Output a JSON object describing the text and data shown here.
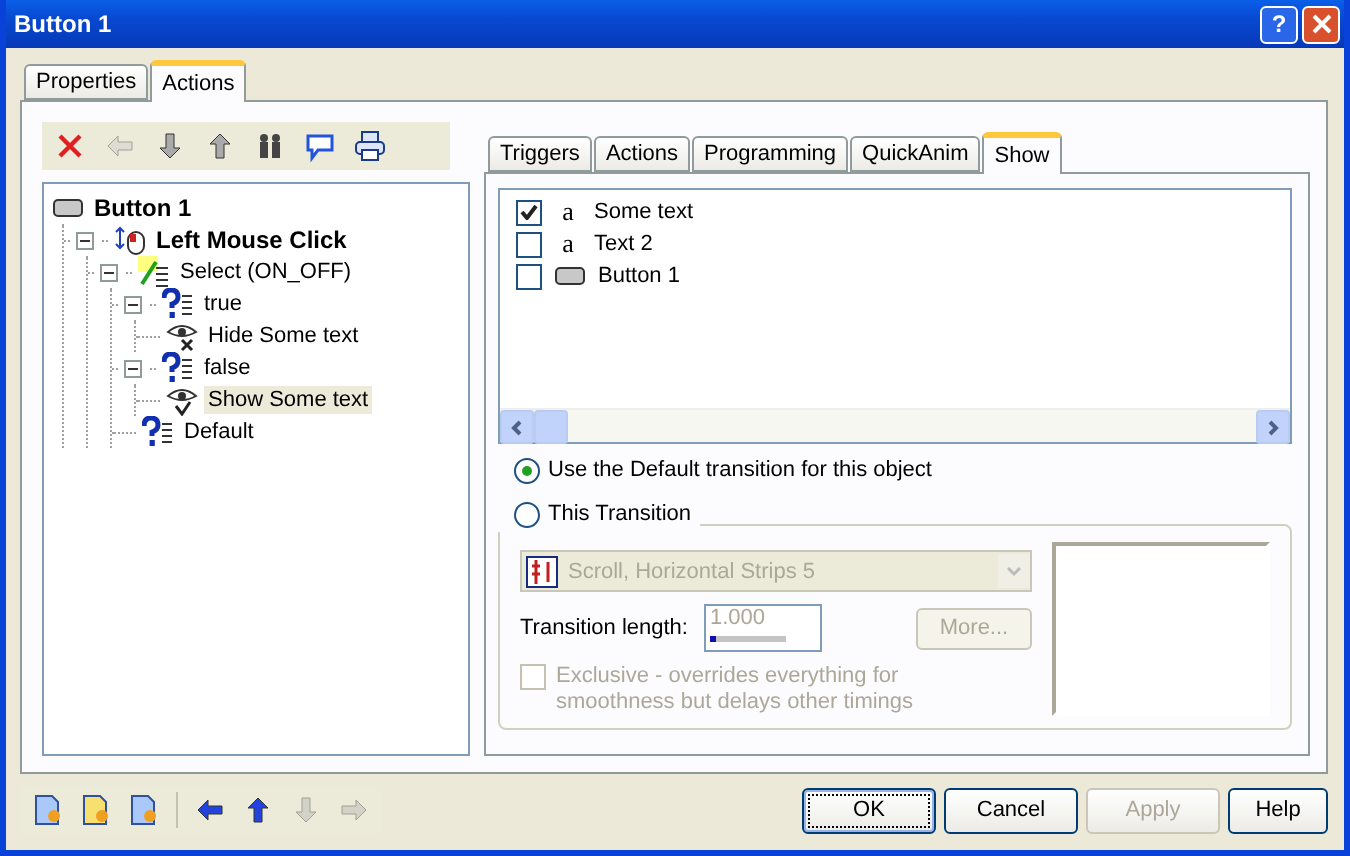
{
  "window": {
    "title": "Button 1",
    "help_button": "?"
  },
  "tabs": [
    {
      "label": "Properties",
      "selected": false
    },
    {
      "label": "Actions",
      "selected": true
    }
  ],
  "action_toolbar": [
    {
      "kind": "delete",
      "disabled": false
    },
    {
      "kind": "left",
      "disabled": true
    },
    {
      "kind": "down",
      "disabled": false
    },
    {
      "kind": "up",
      "disabled": false
    },
    {
      "kind": "people",
      "disabled": false
    },
    {
      "kind": "comment",
      "disabled": false
    },
    {
      "kind": "print",
      "disabled": false
    }
  ],
  "tree": [
    {
      "label": "Button 1",
      "kind": "object",
      "selected": false,
      "children": [
        {
          "label": "Left Mouse Click",
          "kind": "event",
          "selected": false,
          "expanded": true,
          "children": [
            {
              "label": "Select (ON_OFF)",
              "kind": "select",
              "selected": false,
              "expanded": true,
              "children": [
                {
                  "label": "true",
                  "kind": "case",
                  "selected": false,
                  "expanded": true,
                  "children": [
                    {
                      "label": "Hide Some text",
                      "kind": "hide",
                      "selected": false
                    }
                  ]
                },
                {
                  "label": "false",
                  "kind": "case",
                  "selected": false,
                  "expanded": true,
                  "children": [
                    {
                      "label": "Show Some text",
                      "kind": "show",
                      "selected": true
                    }
                  ]
                },
                {
                  "label": "Default",
                  "kind": "case",
                  "selected": false
                }
              ]
            }
          ]
        }
      ]
    }
  ],
  "inner_tabs": [
    {
      "label": "Triggers",
      "selected": false
    },
    {
      "label": "Actions",
      "selected": false
    },
    {
      "label": "Programming",
      "selected": false
    },
    {
      "label": "QuickAnim",
      "selected": false
    },
    {
      "label": "Show",
      "selected": true
    }
  ],
  "show_list": [
    {
      "label": "Some text",
      "kind": "text",
      "icon": "a",
      "checked": true
    },
    {
      "label": "Text 2",
      "kind": "text",
      "icon": "a",
      "checked": false
    },
    {
      "label": "Button 1",
      "kind": "button",
      "checked": false
    }
  ],
  "transition_options": [
    {
      "label": "Use the Default transition for this object",
      "selected": true
    },
    {
      "label": "This Transition",
      "selected": false
    }
  ],
  "transition": {
    "disabled": true,
    "effect": "Scroll, Horizontal Strips 5",
    "length_label": "Transition length:",
    "length_value": "1.000",
    "length_bar": {
      "level": 0.08
    },
    "more_button": "More...",
    "exclusive": {
      "label": "Exclusive - overrides everything for smoothness but delays other timings",
      "checked": false
    }
  },
  "bottom_toolbar": [
    {
      "kind": "page-add",
      "disabled": false
    },
    {
      "kind": "page-edit",
      "disabled": false
    },
    {
      "kind": "page-edit-blue",
      "disabled": false
    },
    {
      "kind": "left",
      "disabled": false
    },
    {
      "kind": "up",
      "disabled": false
    },
    {
      "kind": "down",
      "disabled": true
    },
    {
      "kind": "right",
      "disabled": true
    }
  ],
  "buttons": [
    {
      "label": "OK",
      "disabled": false,
      "default": true
    },
    {
      "label": "Cancel",
      "disabled": false,
      "default": false
    },
    {
      "label": "Apply",
      "disabled": true,
      "default": false
    },
    {
      "label": "Help",
      "disabled": false,
      "default": false
    }
  ]
}
